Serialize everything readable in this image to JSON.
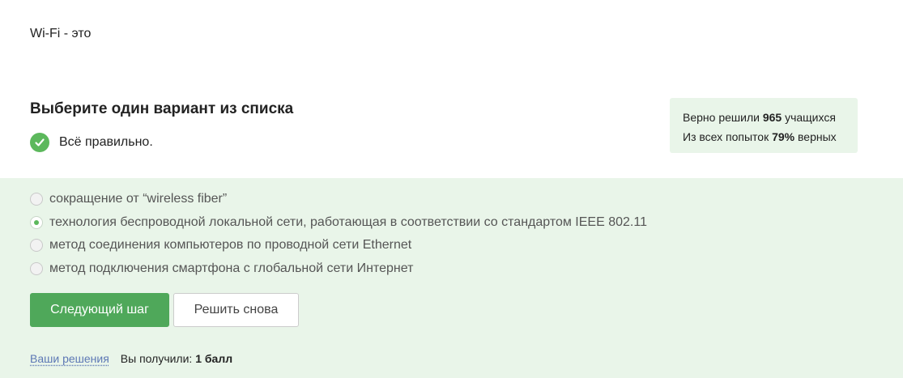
{
  "question": {
    "text": "Wi-Fi - это"
  },
  "instruction": "Выберите один вариант из списка",
  "result": {
    "text": "Всё правильно.",
    "icon": "check-circle-icon",
    "color": "#5cb85c"
  },
  "stats": {
    "line1_prefix": "Верно решили ",
    "solved_count": "965",
    "line1_suffix": " учащихся",
    "line2_prefix": "Из всех попыток ",
    "percent": "79%",
    "line2_suffix": " верных"
  },
  "options": [
    {
      "label": "сокращение от “wireless fiber”",
      "selected": false
    },
    {
      "label": "технология беспроводной локальной сети, работающая в соответствии со стандартом IEEE 802.11",
      "selected": true
    },
    {
      "label": "метод соединения компьютеров по проводной сети Ethernet",
      "selected": false
    },
    {
      "label": "метод подключения смартфона с глобальной сети Интернет",
      "selected": false
    }
  ],
  "buttons": {
    "next_label": "Следующий шаг",
    "retry_label": "Решить снова"
  },
  "footer": {
    "solutions_link": "Ваши решения",
    "received_prefix": "Вы получили: ",
    "received_points": "1 балл"
  },
  "colors": {
    "accent": "#4fa85a",
    "success_bg": "#e9f5e9",
    "link": "#5d78b5"
  }
}
